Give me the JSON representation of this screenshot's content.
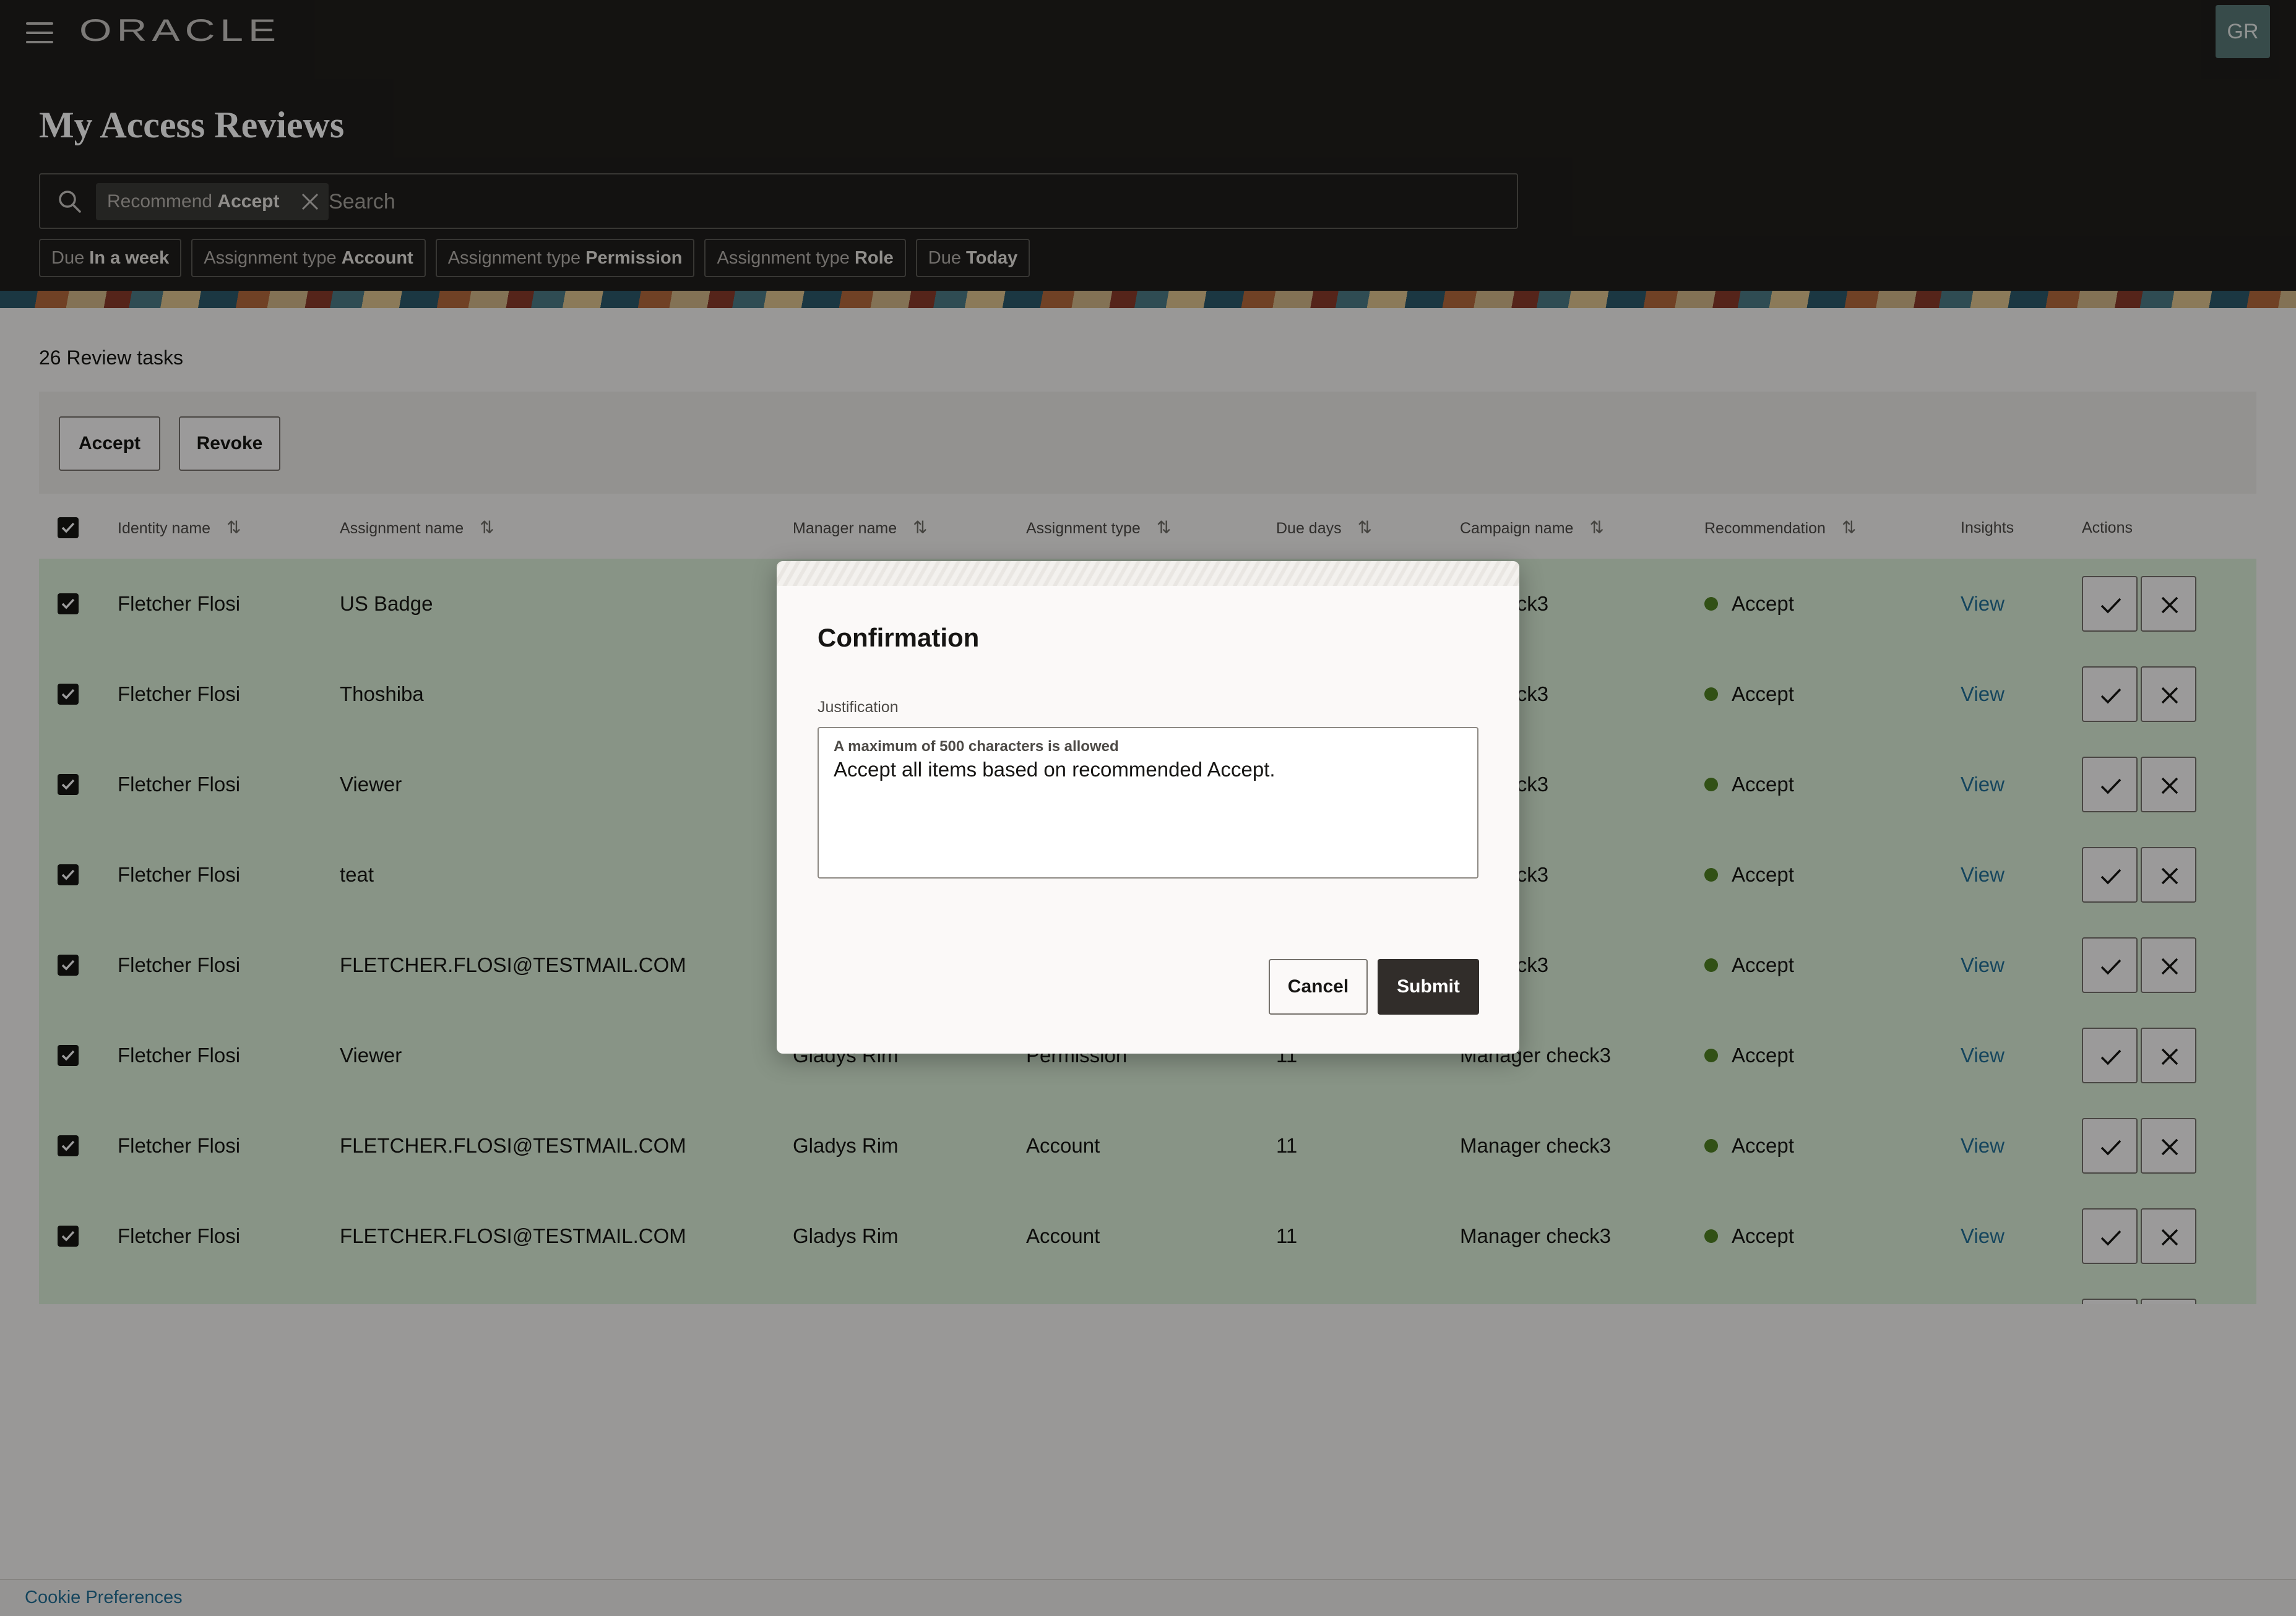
{
  "header": {
    "logo": "ORACLE",
    "avatar": "GR",
    "title": "My Access Reviews",
    "search": {
      "chip_prefix": "Recommend",
      "chip_value": "Accept",
      "placeholder": "Search"
    },
    "filters": [
      {
        "prefix": "Due",
        "value": "In a week"
      },
      {
        "prefix": "Assignment type",
        "value": "Account"
      },
      {
        "prefix": "Assignment type",
        "value": "Permission"
      },
      {
        "prefix": "Assignment type",
        "value": "Role"
      },
      {
        "prefix": "Due",
        "value": "Today"
      }
    ]
  },
  "main": {
    "task_count": "26 Review tasks",
    "toolbar": {
      "accept_label": "Accept",
      "revoke_label": "Revoke"
    },
    "columns": [
      "Identity name",
      "Assignment name",
      "Manager name",
      "Assignment type",
      "Due days",
      "Campaign name",
      "Recommendation",
      "Insights",
      "Actions"
    ],
    "rows": [
      {
        "identity": "Fletcher Flosi",
        "assignment": "US Badge",
        "manager": "",
        "type": "",
        "due": "",
        "campaign": "er check3",
        "recommendation": "Accept",
        "insights": "View"
      },
      {
        "identity": "Fletcher Flosi",
        "assignment": "Thoshiba",
        "manager": "",
        "type": "",
        "due": "",
        "campaign": "er check3",
        "recommendation": "Accept",
        "insights": "View"
      },
      {
        "identity": "Fletcher Flosi",
        "assignment": "Viewer",
        "manager": "",
        "type": "",
        "due": "",
        "campaign": "er check3",
        "recommendation": "Accept",
        "insights": "View"
      },
      {
        "identity": "Fletcher Flosi",
        "assignment": "teat",
        "manager": "",
        "type": "",
        "due": "",
        "campaign": "er check3",
        "recommendation": "Accept",
        "insights": "View"
      },
      {
        "identity": "Fletcher Flosi",
        "assignment": "FLETCHER.FLOSI@TESTMAIL.COM",
        "manager": "",
        "type": "",
        "due": "",
        "campaign": "er check3",
        "recommendation": "Accept",
        "insights": "View"
      },
      {
        "identity": "Fletcher Flosi",
        "assignment": "Viewer",
        "manager": "Gladys Rim",
        "type": "Permission",
        "due": "11",
        "campaign": "Manager check3",
        "recommendation": "Accept",
        "insights": "View"
      },
      {
        "identity": "Fletcher Flosi",
        "assignment": "FLETCHER.FLOSI@TESTMAIL.COM",
        "manager": "Gladys Rim",
        "type": "Account",
        "due": "11",
        "campaign": "Manager check3",
        "recommendation": "Accept",
        "insights": "View"
      },
      {
        "identity": "Fletcher Flosi",
        "assignment": "FLETCHER.FLOSI@TESTMAIL.COM",
        "manager": "Gladys Rim",
        "type": "Account",
        "due": "11",
        "campaign": "Manager check3",
        "recommendation": "Accept",
        "insights": "View"
      }
    ]
  },
  "dialog": {
    "title": "Confirmation",
    "field_label": "Justification",
    "hint": "A maximum of 500 characters is allowed",
    "value": "Accept all items based on recommended Accept.",
    "cancel_label": "Cancel",
    "submit_label": "Submit"
  },
  "footer": {
    "cookie_label": "Cookie Preferences"
  },
  "colors": {
    "header_bg": "#201e1c",
    "row_selected_bg": "#dcefd9",
    "accept_dot": "#508223",
    "link": "#227097",
    "submit_bg": "#312d2a"
  }
}
